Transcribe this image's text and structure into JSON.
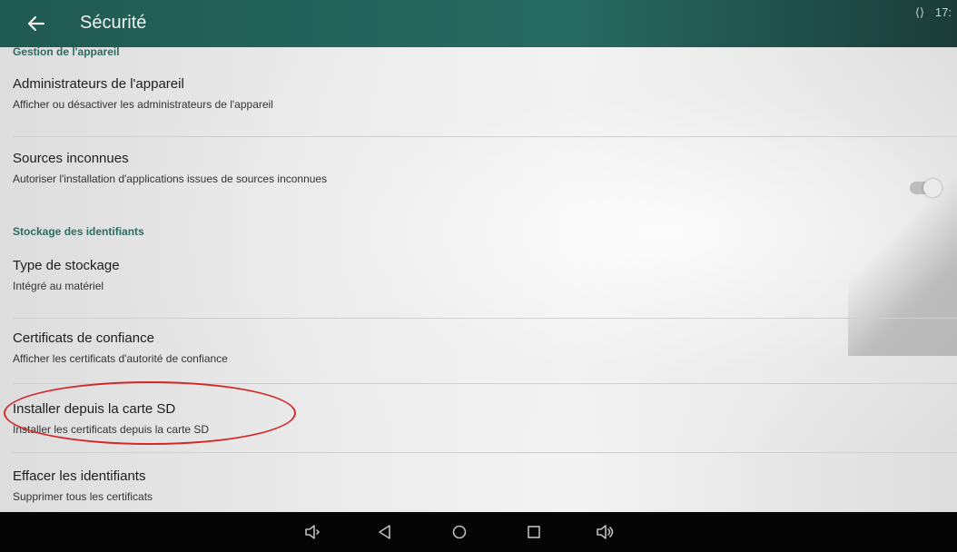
{
  "topbar": {
    "title": "Sécurité",
    "status_time": "17:",
    "icons": {
      "back": "back-arrow-icon",
      "status": "vpn-icon"
    }
  },
  "sections": {
    "device_management": "Gestion de l'appareil",
    "credential_storage": "Stockage des identifiants"
  },
  "items": [
    {
      "title": "Administrateurs de l'appareil",
      "subtitle": "Afficher ou désactiver les administrateurs de l'appareil"
    },
    {
      "title": "Sources inconnues",
      "subtitle": "Autoriser l'installation d'applications issues de sources inconnues",
      "toggle": false
    },
    {
      "title": "Type de stockage",
      "subtitle": "Intégré au matériel"
    },
    {
      "title": "Certificats de confiance",
      "subtitle": "Afficher les certificats d'autorité de confiance"
    },
    {
      "title": "Installer depuis la carte SD",
      "subtitle": "Installer les certificats depuis la carte SD"
    },
    {
      "title": "Effacer les identifiants",
      "subtitle": "Supprimer tous les certificats"
    }
  ],
  "navbar": {
    "icons": [
      "volume-down-icon",
      "back-triangle-icon",
      "home-circle-icon",
      "recents-square-icon",
      "volume-up-icon"
    ]
  },
  "colors": {
    "accent": "#2a6d63",
    "highlight": "#d52828"
  }
}
